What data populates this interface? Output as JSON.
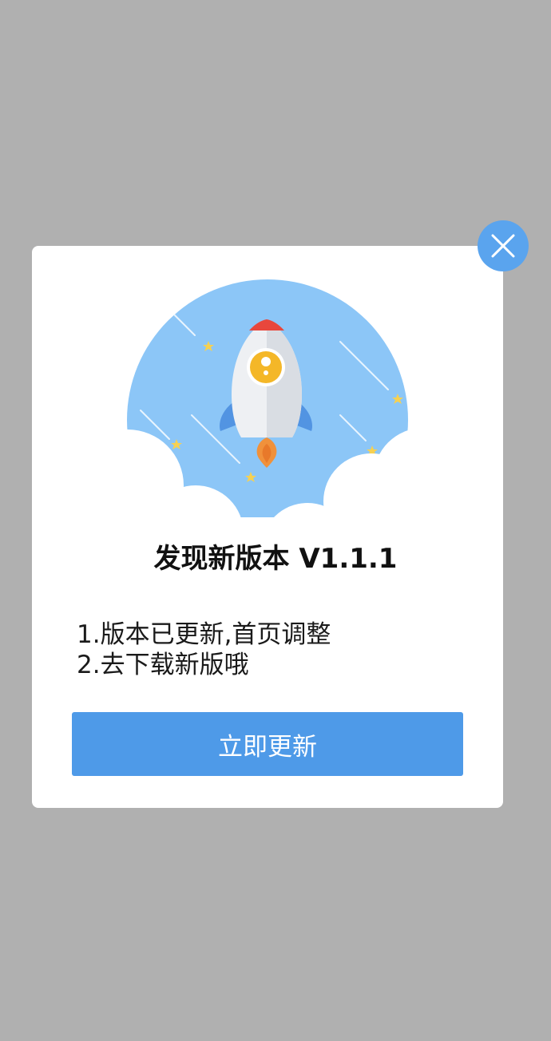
{
  "dialog": {
    "title": "发现新版本 V1.1.1",
    "notes": [
      "1.版本已更新,首页调整",
      "2.去下载新版哦"
    ],
    "update_label": "立即更新",
    "close_icon": "close-icon",
    "illustration_icon": "rocket-icon"
  },
  "colors": {
    "overlay": "#b0b0b0",
    "dialog_bg": "#ffffff",
    "accent": "#4e9ae8",
    "close_bg": "#5aa4ee",
    "sky": "#8cc6f7"
  }
}
